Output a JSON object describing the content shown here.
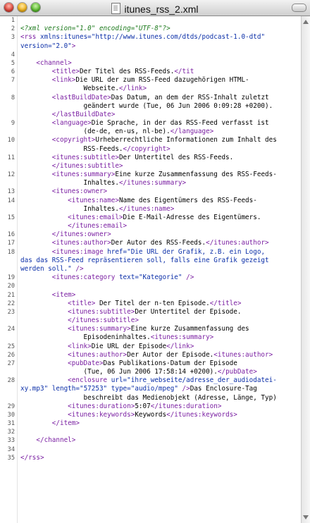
{
  "window": {
    "title": "itunes_rss_2.xml"
  },
  "colors": {
    "tag": "#7a1fa2",
    "attr": "#0b2fa8",
    "value": "#0b2fa8",
    "text": "#000000",
    "decl": "#1d7a1d"
  },
  "lines": [
    {
      "n": "1",
      "parts": []
    },
    {
      "n": "2",
      "parts": [
        {
          "c": "decl",
          "t": "<?xml version=\"1.0\" encoding=\"UTF-8\"?>"
        }
      ]
    },
    {
      "n": "3",
      "parts": [
        {
          "c": "tag",
          "t": "<rss "
        },
        {
          "c": "attr",
          "t": "xmlns:itunes="
        },
        {
          "c": "value",
          "t": "\"http://www.itunes.com/dtds/podcast-1.0-dtd\""
        }
      ]
    },
    {
      "n": "",
      "parts": [
        {
          "c": "attr",
          "t": "version="
        },
        {
          "c": "value",
          "t": "\"2.0\""
        },
        {
          "c": "tag",
          "t": ">"
        }
      ]
    },
    {
      "n": "4",
      "parts": []
    },
    {
      "n": "5",
      "parts": [
        {
          "c": "tag",
          "t": "    <channel>"
        }
      ]
    },
    {
      "n": "6",
      "parts": [
        {
          "c": "tag",
          "t": "        <title>"
        },
        {
          "c": "text",
          "t": "Der Titel des RSS-Feeds."
        },
        {
          "c": "tag",
          "t": "</tit"
        }
      ]
    },
    {
      "n": "7",
      "parts": [
        {
          "c": "tag",
          "t": "        <link>"
        },
        {
          "c": "text",
          "t": "Die URL der zum RSS-Feed dazugehörigen HTML-"
        }
      ]
    },
    {
      "n": "",
      "parts": [
        {
          "c": "text",
          "t": "                Webseite."
        },
        {
          "c": "tag",
          "t": "</link>"
        }
      ]
    },
    {
      "n": "8",
      "parts": [
        {
          "c": "tag",
          "t": "        <lastBuildDate>"
        },
        {
          "c": "text",
          "t": "Das Datum, an dem der RSS-Inhalt zuletzt"
        }
      ]
    },
    {
      "n": "",
      "parts": [
        {
          "c": "text",
          "t": "                geändert wurde (Tue, 06 Jun 2006 0:09:28 +0200)."
        }
      ]
    },
    {
      "n": "",
      "parts": [
        {
          "c": "tag",
          "t": "        </lastBuildDate>"
        }
      ]
    },
    {
      "n": "9",
      "parts": [
        {
          "c": "tag",
          "t": "        <language>"
        },
        {
          "c": "text",
          "t": "Die Sprache, in der das RSS-Feed verfasst ist"
        }
      ]
    },
    {
      "n": "",
      "parts": [
        {
          "c": "text",
          "t": "                (de-de, en-us, nl-be)."
        },
        {
          "c": "tag",
          "t": "</language>"
        }
      ]
    },
    {
      "n": "10",
      "parts": [
        {
          "c": "tag",
          "t": "        <copyright>"
        },
        {
          "c": "text",
          "t": "Urheberrechtliche Informationen zum Inhalt des"
        }
      ]
    },
    {
      "n": "",
      "parts": [
        {
          "c": "text",
          "t": "                RSS-Feeds."
        },
        {
          "c": "tag",
          "t": "</copyright>"
        }
      ]
    },
    {
      "n": "11",
      "parts": [
        {
          "c": "tag",
          "t": "        <itunes:subtitle>"
        },
        {
          "c": "text",
          "t": "Der Untertitel des RSS-Feeds."
        }
      ]
    },
    {
      "n": "",
      "parts": [
        {
          "c": "tag",
          "t": "        </itunes:subtitle>"
        }
      ]
    },
    {
      "n": "12",
      "parts": [
        {
          "c": "tag",
          "t": "        <itunes:summary>"
        },
        {
          "c": "text",
          "t": "Eine kurze Zusammenfassung des RSS-Feeds-"
        }
      ]
    },
    {
      "n": "",
      "parts": [
        {
          "c": "text",
          "t": "                Inhaltes."
        },
        {
          "c": "tag",
          "t": "</itunes:summary>"
        }
      ]
    },
    {
      "n": "13",
      "parts": [
        {
          "c": "tag",
          "t": "        <itunes:owner>"
        }
      ]
    },
    {
      "n": "14",
      "parts": [
        {
          "c": "tag",
          "t": "            <itunes:name>"
        },
        {
          "c": "text",
          "t": "Name des Eigentümers des RSS-Feeds-"
        }
      ]
    },
    {
      "n": "",
      "parts": [
        {
          "c": "text",
          "t": "                Inhaltes."
        },
        {
          "c": "tag",
          "t": "</itunes:name>"
        }
      ]
    },
    {
      "n": "15",
      "parts": [
        {
          "c": "tag",
          "t": "            <itunes:email>"
        },
        {
          "c": "text",
          "t": "Die E-Mail-Adresse des Eigentümers."
        }
      ]
    },
    {
      "n": "",
      "parts": [
        {
          "c": "tag",
          "t": "            </itunes:email>"
        }
      ]
    },
    {
      "n": "16",
      "parts": [
        {
          "c": "tag",
          "t": "        </itunes:owner>"
        }
      ]
    },
    {
      "n": "17",
      "parts": [
        {
          "c": "tag",
          "t": "        <itunes:author>"
        },
        {
          "c": "text",
          "t": "Der Autor des RSS-Feeds."
        },
        {
          "c": "tag",
          "t": "</itunes:author>"
        }
      ]
    },
    {
      "n": "18",
      "parts": [
        {
          "c": "tag",
          "t": "        <itunes:image "
        },
        {
          "c": "attr",
          "t": "href="
        },
        {
          "c": "value",
          "t": "\"Die URL der Grafik, z.B. ein Logo,"
        }
      ]
    },
    {
      "n": "",
      "parts": [
        {
          "c": "value",
          "t": "das das RSS-Feed repräsentieren soll, falls eine Grafik gezeigt"
        }
      ]
    },
    {
      "n": "",
      "parts": [
        {
          "c": "value",
          "t": "werden soll.\""
        },
        {
          "c": "tag",
          "t": " />"
        }
      ]
    },
    {
      "n": "19",
      "parts": [
        {
          "c": "tag",
          "t": "        <itunes:category "
        },
        {
          "c": "attr",
          "t": "text="
        },
        {
          "c": "value",
          "t": "\"Kategorie\""
        },
        {
          "c": "tag",
          "t": " />"
        }
      ]
    },
    {
      "n": "20",
      "parts": []
    },
    {
      "n": "21",
      "parts": [
        {
          "c": "tag",
          "t": "        <item>"
        }
      ]
    },
    {
      "n": "22",
      "parts": [
        {
          "c": "tag",
          "t": "            <title>"
        },
        {
          "c": "text",
          "t": " Der Titel der n-ten Episode."
        },
        {
          "c": "tag",
          "t": "</title>"
        }
      ]
    },
    {
      "n": "23",
      "parts": [
        {
          "c": "tag",
          "t": "            <itunes:subtitle>"
        },
        {
          "c": "text",
          "t": "Der Untertitel der Episode."
        }
      ]
    },
    {
      "n": "",
      "parts": [
        {
          "c": "tag",
          "t": "            </itunes:subtitle>"
        }
      ]
    },
    {
      "n": "24",
      "parts": [
        {
          "c": "tag",
          "t": "            <itunes:summary>"
        },
        {
          "c": "text",
          "t": "Eine kurze Zusammenfassung des"
        }
      ]
    },
    {
      "n": "",
      "parts": [
        {
          "c": "text",
          "t": "                Episodeninhaltes."
        },
        {
          "c": "tag",
          "t": "<itunes:summary>"
        }
      ]
    },
    {
      "n": "25",
      "parts": [
        {
          "c": "tag",
          "t": "            <link>"
        },
        {
          "c": "text",
          "t": "Die URL der Episode"
        },
        {
          "c": "tag",
          "t": "</link>"
        }
      ]
    },
    {
      "n": "26",
      "parts": [
        {
          "c": "tag",
          "t": "            <itunes:author>"
        },
        {
          "c": "text",
          "t": "Der Autor der Episode."
        },
        {
          "c": "tag",
          "t": "<itunes:author>"
        }
      ]
    },
    {
      "n": "27",
      "parts": [
        {
          "c": "tag",
          "t": "            <pubDate>"
        },
        {
          "c": "text",
          "t": "Das Publikations-Datum der Episode"
        }
      ]
    },
    {
      "n": "",
      "parts": [
        {
          "c": "text",
          "t": "                (Tue, 06 Jun 2006 17:58:14 +0200)."
        },
        {
          "c": "tag",
          "t": "</pubDate>"
        }
      ]
    },
    {
      "n": "28",
      "parts": [
        {
          "c": "tag",
          "t": "            <enclosure "
        },
        {
          "c": "attr",
          "t": "url="
        },
        {
          "c": "value",
          "t": "\"ihre_webseite/adresse_der_audiodatei-"
        }
      ]
    },
    {
      "n": "",
      "parts": [
        {
          "c": "value",
          "t": "xy.mp3\""
        },
        {
          "c": "attr",
          "t": " length="
        },
        {
          "c": "value",
          "t": "\"57253\""
        },
        {
          "c": "attr",
          "t": " type="
        },
        {
          "c": "value",
          "t": "\"audio/mpeg\""
        },
        {
          "c": "tag",
          "t": " />"
        },
        {
          "c": "text",
          "t": "Das Enclosure-Tag"
        }
      ]
    },
    {
      "n": "",
      "parts": [
        {
          "c": "text",
          "t": "                beschreibt das Medienobjekt (Adresse, Länge, Typ)"
        }
      ]
    },
    {
      "n": "29",
      "parts": [
        {
          "c": "tag",
          "t": "            <itunes:duration>"
        },
        {
          "c": "text",
          "t": "5:07"
        },
        {
          "c": "tag",
          "t": "</itunes:duration>"
        }
      ]
    },
    {
      "n": "30",
      "parts": [
        {
          "c": "tag",
          "t": "            <itunes:keywords>"
        },
        {
          "c": "text",
          "t": "Keywords"
        },
        {
          "c": "tag",
          "t": "</itunes:keywords>"
        }
      ]
    },
    {
      "n": "31",
      "parts": [
        {
          "c": "tag",
          "t": "        </item>"
        }
      ]
    },
    {
      "n": "32",
      "parts": []
    },
    {
      "n": "33",
      "parts": [
        {
          "c": "tag",
          "t": "    </channel>"
        }
      ]
    },
    {
      "n": "34",
      "parts": []
    },
    {
      "n": "35",
      "parts": [
        {
          "c": "tag",
          "t": "</rss>"
        }
      ]
    }
  ]
}
